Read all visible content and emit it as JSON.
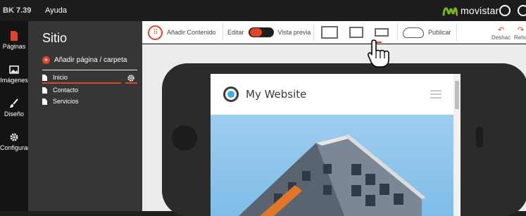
{
  "topbar": {
    "version": "BK 7.39",
    "help": "Ayuda",
    "brand": "movistar",
    "brand_color": "#7ab51d"
  },
  "leftnav": {
    "items": [
      {
        "label": "Páginas",
        "icon": "page-icon"
      },
      {
        "label": "Imágenes",
        "icon": "image-icon"
      },
      {
        "label": "Diseño",
        "icon": "brush-icon"
      },
      {
        "label": "Configurar",
        "icon": "gear-icon"
      }
    ]
  },
  "sidepanel": {
    "title": "Sitio",
    "add_page": "Añadir página / carpeta",
    "pages": [
      {
        "label": "Inicio",
        "active": true
      },
      {
        "label": "Contacto",
        "active": false
      },
      {
        "label": "Servicios",
        "active": false
      }
    ]
  },
  "toolbar": {
    "add_content": "Añadir Contenido",
    "edit": "Editar",
    "preview": "Vista previa",
    "publish": "Publicar",
    "undo": "Deshac",
    "redo": "Rehu"
  },
  "preview": {
    "site_name": "My Website"
  },
  "colors": {
    "accent": "#e0442a",
    "sidebar": "#363636",
    "nav": "#141414"
  }
}
